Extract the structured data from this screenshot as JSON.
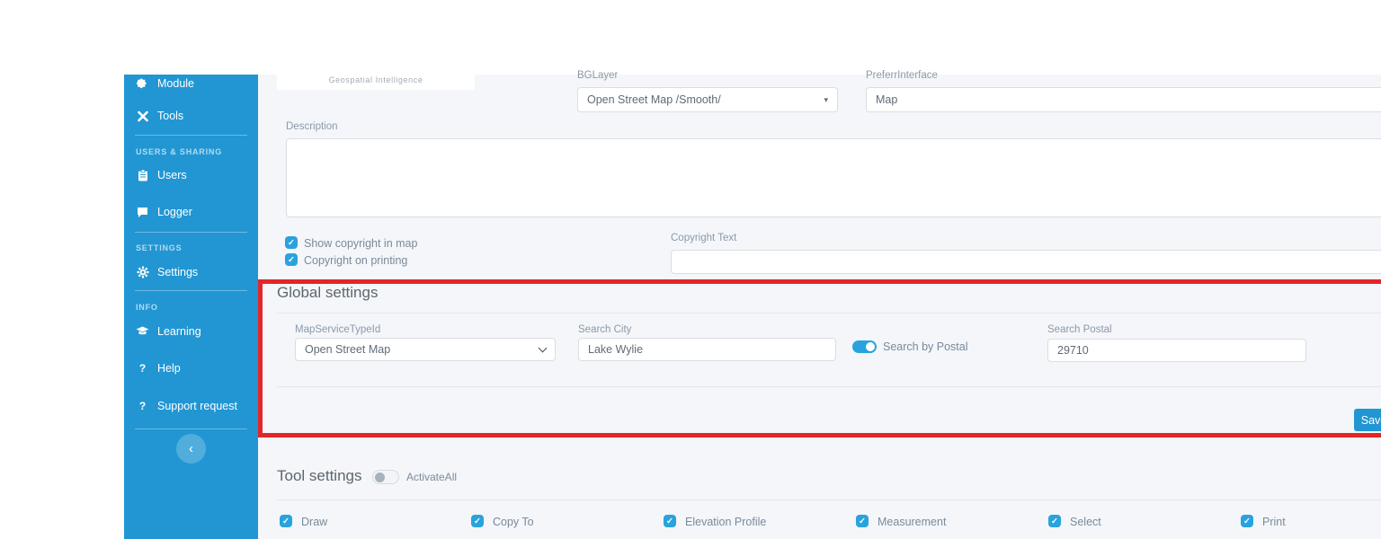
{
  "brand": {
    "tagline": "Geospatial Intelligence"
  },
  "colors": {
    "sidebar": "#2196d3",
    "accent": "#29a3dd",
    "highlight": "#e42528",
    "background": "#f4f6f9"
  },
  "sidebar": {
    "items": [
      {
        "type": "item",
        "label": "Module",
        "icon": "puzzle-icon"
      },
      {
        "type": "item",
        "label": "Tools",
        "icon": "tools-icon"
      },
      {
        "type": "divider"
      },
      {
        "type": "header",
        "label": "USERS & SHARING"
      },
      {
        "type": "item",
        "label": "Users",
        "icon": "clipboard-icon"
      },
      {
        "type": "item",
        "label": "Logger",
        "icon": "chat-icon"
      },
      {
        "type": "divider"
      },
      {
        "type": "header",
        "label": "SETTINGS"
      },
      {
        "type": "item",
        "label": "Settings",
        "icon": "gear-icon"
      },
      {
        "type": "divider"
      },
      {
        "type": "header",
        "label": "INFO"
      },
      {
        "type": "item",
        "label": "Learning",
        "icon": "graduation-cap-icon"
      },
      {
        "type": "item",
        "label": "Help",
        "icon": "question-icon"
      },
      {
        "type": "item",
        "label": "Support request",
        "icon": "question-icon"
      },
      {
        "type": "divider"
      },
      {
        "type": "collapse",
        "icon": "chevron-left-icon",
        "glyph": "‹"
      }
    ]
  },
  "map_settings": {
    "bglayer": {
      "label": "BGLayer",
      "value": "Open Street Map /Smooth/"
    },
    "preferrinterface": {
      "label": "PreferrInterface",
      "value": "Map"
    },
    "description": {
      "label": "Description",
      "value": ""
    },
    "copyright_checkboxes": [
      {
        "label": "Show copyright in map",
        "checked": true
      },
      {
        "label": "Copyright on printing",
        "checked": true
      }
    ],
    "copyright_text": {
      "label": "Copyright Text",
      "value": ""
    },
    "check_glyph": "✓"
  },
  "global_settings": {
    "title": "Global settings",
    "map_service_type": {
      "label": "MapServiceTypeId",
      "value": "Open Street Map"
    },
    "search_city": {
      "label": "Search City",
      "value": "Lake Wylie"
    },
    "search_by_postal": {
      "label": "Search by Postal",
      "on": true
    },
    "search_postal": {
      "label": "Search Postal",
      "value": "29710"
    },
    "save_label": "Save"
  },
  "tool_settings": {
    "title": "Tool settings",
    "activate_all": {
      "label": "ActivateAll",
      "on": false
    },
    "tools": [
      {
        "label": "Draw",
        "checked": true
      },
      {
        "label": "Copy To",
        "checked": true
      },
      {
        "label": "Elevation Profile",
        "checked": true
      },
      {
        "label": "Measurement",
        "checked": true
      },
      {
        "label": "Select",
        "checked": true
      },
      {
        "label": "Print",
        "checked": true
      }
    ]
  }
}
